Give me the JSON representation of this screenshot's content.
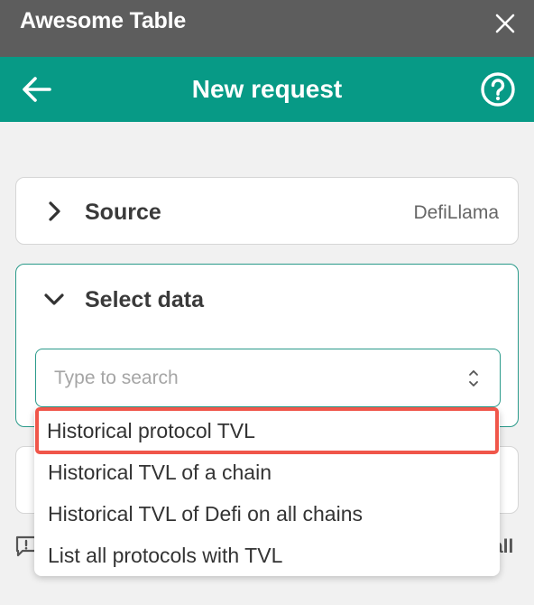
{
  "window": {
    "title": "Awesome Table",
    "close_icon": "close-icon"
  },
  "header": {
    "title": "New request",
    "back_icon": "arrow-left-icon",
    "help_icon": "help-circle-icon"
  },
  "source_section": {
    "title": "Source",
    "value": "DefiLlama",
    "icon": "chevron-right-icon"
  },
  "select_section": {
    "title": "Select data",
    "icon": "chevron-down-icon",
    "search": {
      "placeholder": "Type to search",
      "value": ""
    }
  },
  "dropdown": {
    "options": [
      "Historical protocol TVL",
      "Historical TVL of a chain",
      "Historical TVL of Defi on all chains",
      "List all protocols with TVL"
    ],
    "highlighted_index": 0
  },
  "footer": {
    "link_text": "all",
    "feedback_icon": "feedback-icon"
  },
  "colors": {
    "accent": "#079a86",
    "titlebar": "#5d5d5d",
    "highlight": "#f0564a"
  }
}
